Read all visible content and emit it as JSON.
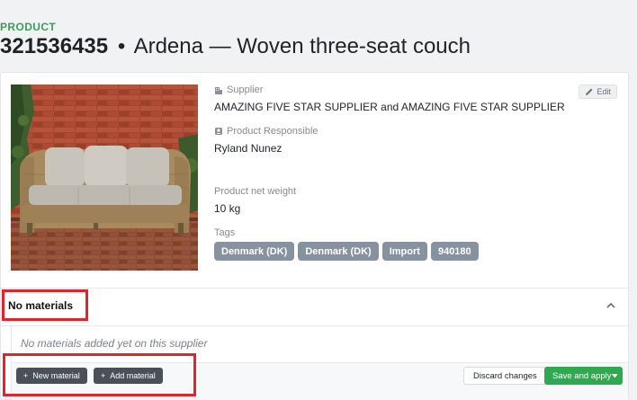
{
  "header": {
    "eyebrow": "PRODUCT",
    "product_id": "321536435",
    "separator": "•",
    "product_name": "Ardena — Woven three-seat couch"
  },
  "details": {
    "edit_label": "Edit",
    "supplier_label": "Supplier",
    "supplier_value": "AMAZING FIVE STAR SUPPLIER and AMAZING FIVE STAR SUPPLIER",
    "responsible_label": "Product Responsible",
    "responsible_value": "Ryland Nunez",
    "weight_label": "Product net weight",
    "weight_value": "10 kg",
    "tags_label": "Tags",
    "tags": [
      "Denmark (DK)",
      "Denmark (DK)",
      "Import",
      "940180"
    ]
  },
  "materials": {
    "title": "No materials",
    "empty_message": "No materials added yet on this supplier",
    "new_material_label": "New material",
    "add_material_label": "Add material",
    "discard_label": "Discard changes",
    "save_label": "Save and apply"
  },
  "colors": {
    "accent_green": "#3e9b5c",
    "save_green": "#2fa94f",
    "tag_gray": "#8792a0",
    "dark_button": "#4a5058",
    "highlight_red": "#e0242b"
  },
  "icons": {
    "supplier": "building-icon",
    "responsible": "person-badge-icon",
    "edit": "pencil-icon",
    "collapse": "chevron-up-icon",
    "plus": "plus-icon",
    "dropdown": "caret-down-icon"
  }
}
